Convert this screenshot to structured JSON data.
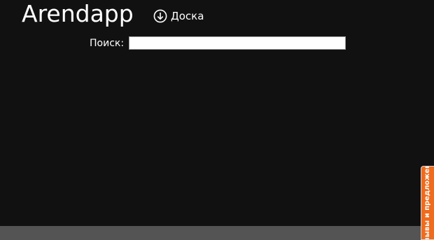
{
  "header": {
    "app_title": "Arendapp",
    "board_link_label": "Доска",
    "board_link_icon": "circle-arrow-down-icon"
  },
  "search": {
    "label": "Поиск:",
    "value": "",
    "placeholder": ""
  },
  "feedback_tab": {
    "label": "Отзывы и предложения",
    "color": "#ef6b1d"
  },
  "colors": {
    "background": "#111111",
    "bottom_bar": "#545454",
    "text": "#ffffff"
  }
}
